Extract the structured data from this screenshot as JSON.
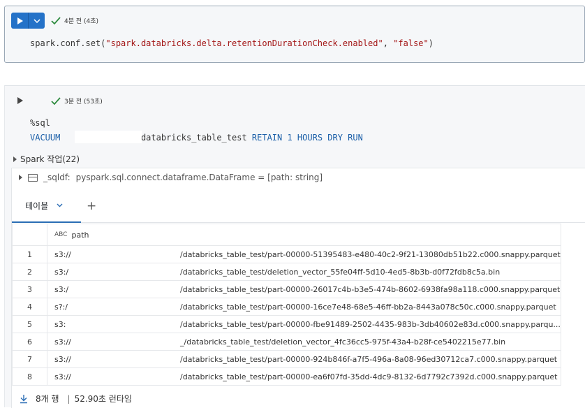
{
  "cell1": {
    "status_text": "4분 전 (4초)",
    "code_prefix": "spark.conf.set(",
    "code_string1": "\"spark.databricks.delta.retentionDurationCheck.enabled\"",
    "code_sep": ", ",
    "code_string2": "\"false\"",
    "code_suffix": ")"
  },
  "cell2": {
    "status_text": "3분 전 (53초)",
    "magic": "%sql",
    "sql_vacuum": "VACUUM",
    "sql_table": "databricks_table_test",
    "sql_rest": "RETAIN 1 HOURS DRY RUN",
    "spark_jobs_label": "Spark 작업(22)",
    "df_name": "_sqldf:",
    "df_type": "pyspark.sql.connect.dataframe.DataFrame = [path: string]",
    "tab_label": "테이블",
    "plus_label": "+",
    "column_type_icon": "ABC",
    "column_header": "path",
    "rows": [
      {
        "num": "1",
        "path": "s3://",
        "rest": "/databricks_table_test/part-00000-51395483-e480-40c2-9f21-13080db51b22.c000.snappy.parquet"
      },
      {
        "num": "2",
        "path": "s3:/",
        "rest": "/databricks_table_test/deletion_vector_55fe04ff-5d10-4ed5-8b3b-d0f72fdb8c5a.bin"
      },
      {
        "num": "3",
        "path": "s3:/",
        "rest": "/databricks_table_test/part-00000-26017c4b-b3e5-474b-8602-6938fa98a118.c000.snappy.parquet"
      },
      {
        "num": "4",
        "path": "s?:/",
        "rest": "/databricks_table_test/part-00000-16ce7e48-68e5-46ff-bb2a-8443a078c50c.c000.snappy.parquet"
      },
      {
        "num": "5",
        "path": "s3:",
        "rest": "/databricks_table_test/part-00000-fbe91489-2502-4435-983b-3db40602e83d.c000.snappy.parqu..."
      },
      {
        "num": "6",
        "path": "s3://",
        "rest": "_/databricks_table_test/deletion_vector_4fc36cc5-975f-43a4-b28f-ce5402215e77.bin"
      },
      {
        "num": "7",
        "path": "s3://",
        "rest": "/databricks_table_test/part-00000-924b846f-a7f5-496a-8a08-96ed30712ca7.c000.snappy.parquet"
      },
      {
        "num": "8",
        "path": "s3://",
        "rest": "/databricks_table_test/part-00000-ea6f07fd-35dd-4dc9-8132-6d7792c7392d.c000.snappy.parquet"
      }
    ],
    "footer_rows": "8개 행",
    "footer_sep": "|",
    "footer_runtime": "52.90초 런타임"
  },
  "colors": {
    "run_button": "#2472c8",
    "check": "#2e8b3f",
    "string": "#a31515",
    "keyword": "#1b5fa8",
    "tab_underline": "#2a6db5"
  },
  "icons": [
    "play-icon",
    "chevron-down-icon",
    "check-icon",
    "caret-right-icon",
    "table-icon",
    "download-icon",
    "abc-type-icon",
    "plus-icon"
  ]
}
